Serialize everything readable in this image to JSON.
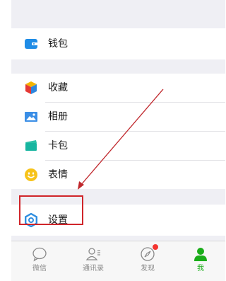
{
  "menu": {
    "wallet": {
      "label": "钱包",
      "icon": "wallet-icon"
    },
    "favorites": {
      "label": "收藏",
      "icon": "cube-icon"
    },
    "album": {
      "label": "相册",
      "icon": "album-icon"
    },
    "cards": {
      "label": "卡包",
      "icon": "card-icon"
    },
    "stickers": {
      "label": "表情",
      "icon": "smiley-icon"
    },
    "settings": {
      "label": "设置",
      "icon": "gear-icon"
    }
  },
  "tabbar": {
    "tabs": [
      {
        "label": "微信",
        "icon": "chat-bubble-icon",
        "active": false
      },
      {
        "label": "通讯录",
        "icon": "contacts-icon",
        "active": false
      },
      {
        "label": "发现",
        "icon": "compass-icon",
        "active": false,
        "badge": true
      },
      {
        "label": "我",
        "icon": "person-icon",
        "active": true
      }
    ]
  },
  "colors": {
    "accent": "#1aad19",
    "annotation": "#d0252a",
    "background": "#efeff4"
  }
}
